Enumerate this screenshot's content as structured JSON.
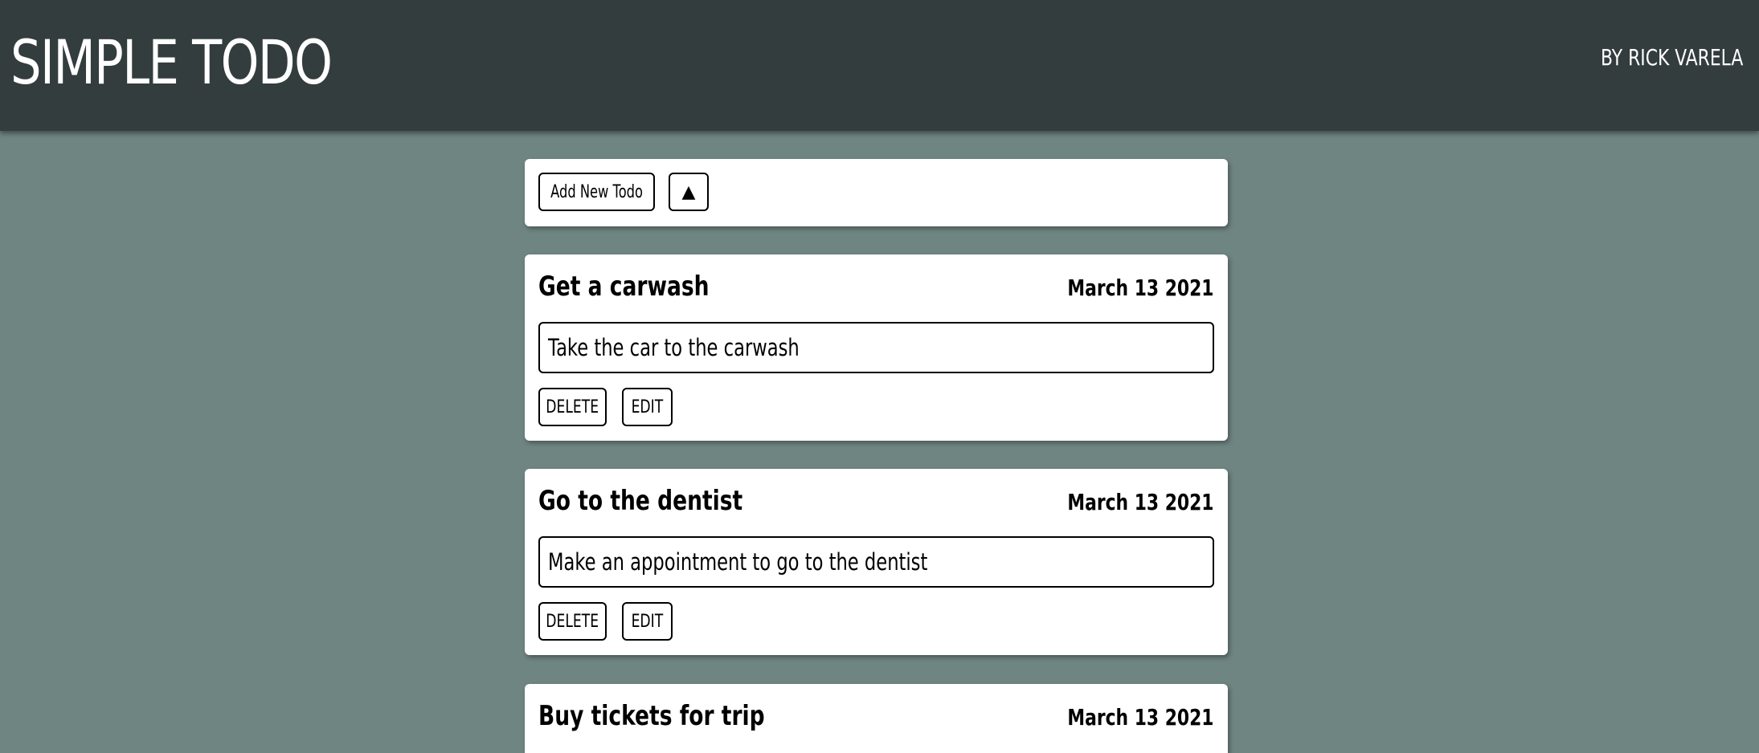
{
  "header": {
    "title": "SIMPLE TODO",
    "byline": "BY RICK VARELA"
  },
  "controls": {
    "add_label": "Add New Todo",
    "toggle_label": "▲"
  },
  "todos": [
    {
      "title": "Get a carwash",
      "date": "March 13 2021",
      "description": "Take the car to the carwash",
      "delete_label": "DELETE",
      "edit_label": "EDIT"
    },
    {
      "title": "Go to the dentist",
      "date": "March 13 2021",
      "description": "Make an appointment to go to the dentist",
      "delete_label": "DELETE",
      "edit_label": "EDIT"
    },
    {
      "title": "Buy tickets for trip",
      "date": "March 13 2021"
    }
  ],
  "colors": {
    "page_background": "#6f8582",
    "header_background": "#343d3d",
    "card_background": "#ffffff",
    "text": "#000000",
    "header_text": "#ffffff"
  }
}
